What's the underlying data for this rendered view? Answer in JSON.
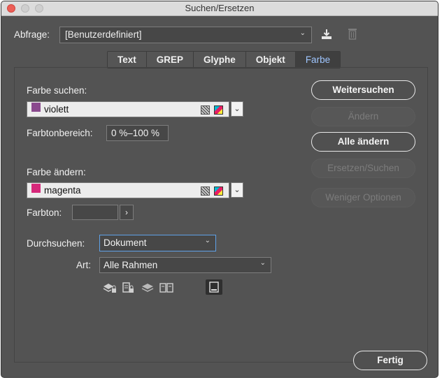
{
  "window": {
    "title": "Suchen/Ersetzen"
  },
  "query": {
    "label": "Abfrage:",
    "value": "[Benutzerdefiniert]",
    "save_icon": "save-query-icon",
    "delete_icon": "trash-icon"
  },
  "tabs": [
    {
      "label": "Text"
    },
    {
      "label": "GREP"
    },
    {
      "label": "Glyphe"
    },
    {
      "label": "Objekt"
    },
    {
      "label": "Farbe",
      "active": true
    }
  ],
  "find_color": {
    "label": "Farbe suchen:",
    "value": "violett",
    "swatch": "#8a4a8e"
  },
  "tint_range": {
    "label": "Farbtonbereich:",
    "value": "0 %–100 %"
  },
  "change_color": {
    "label": "Farbe ändern:",
    "value": "magenta",
    "swatch": "#d6287a"
  },
  "tint": {
    "label": "Farbton:",
    "value": ""
  },
  "search": {
    "label": "Durchsuchen:",
    "value": "Dokument"
  },
  "type": {
    "label": "Art:",
    "value": "Alle Rahmen"
  },
  "buttons": {
    "find_next": "Weitersuchen",
    "change": "Ändern",
    "change_all": "Alle ändern",
    "change_find": "Ersetzen/Suchen",
    "fewer_options": "Weniger Optionen",
    "done": "Fertig"
  },
  "colors": {
    "accent_tab": "#9fc6ff",
    "panel": "#535353",
    "focus": "#5fa2e8"
  }
}
